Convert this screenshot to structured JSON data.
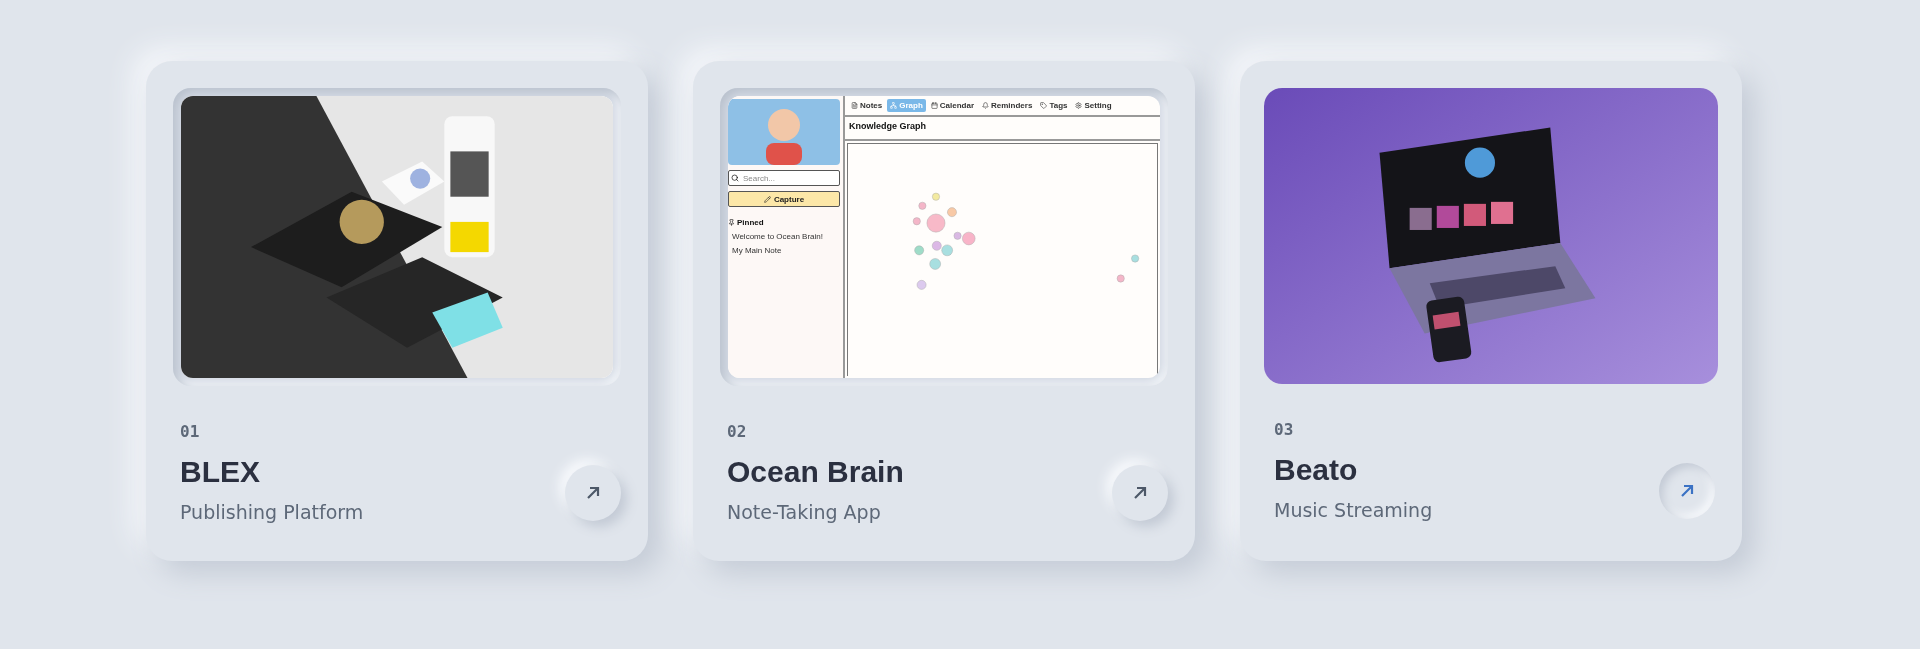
{
  "projects": [
    {
      "number": "01",
      "title": "BLEX",
      "subtitle": "Publishing Platform",
      "active": false
    },
    {
      "number": "02",
      "title": "Ocean Brain",
      "subtitle": "Note-Taking App",
      "active": false,
      "preview": {
        "kind": "app",
        "search": {
          "placeholder": "Search..."
        },
        "capture": "Capture",
        "pinned": {
          "heading": "Pinned",
          "items": [
            "Welcome to Ocean Brain!",
            "My Main Note"
          ]
        },
        "tabs": [
          {
            "label": "Notes",
            "selected": false
          },
          {
            "label": "Graph",
            "selected": true
          },
          {
            "label": "Calendar",
            "selected": false
          },
          {
            "label": "Reminders",
            "selected": false
          },
          {
            "label": "Tags",
            "selected": false
          },
          {
            "label": "Setting",
            "selected": false
          }
        ],
        "graph": {
          "title": "Knowledge Graph"
        }
      }
    },
    {
      "number": "03",
      "title": "Beato",
      "subtitle": "Music Streaming",
      "active": true
    }
  ]
}
